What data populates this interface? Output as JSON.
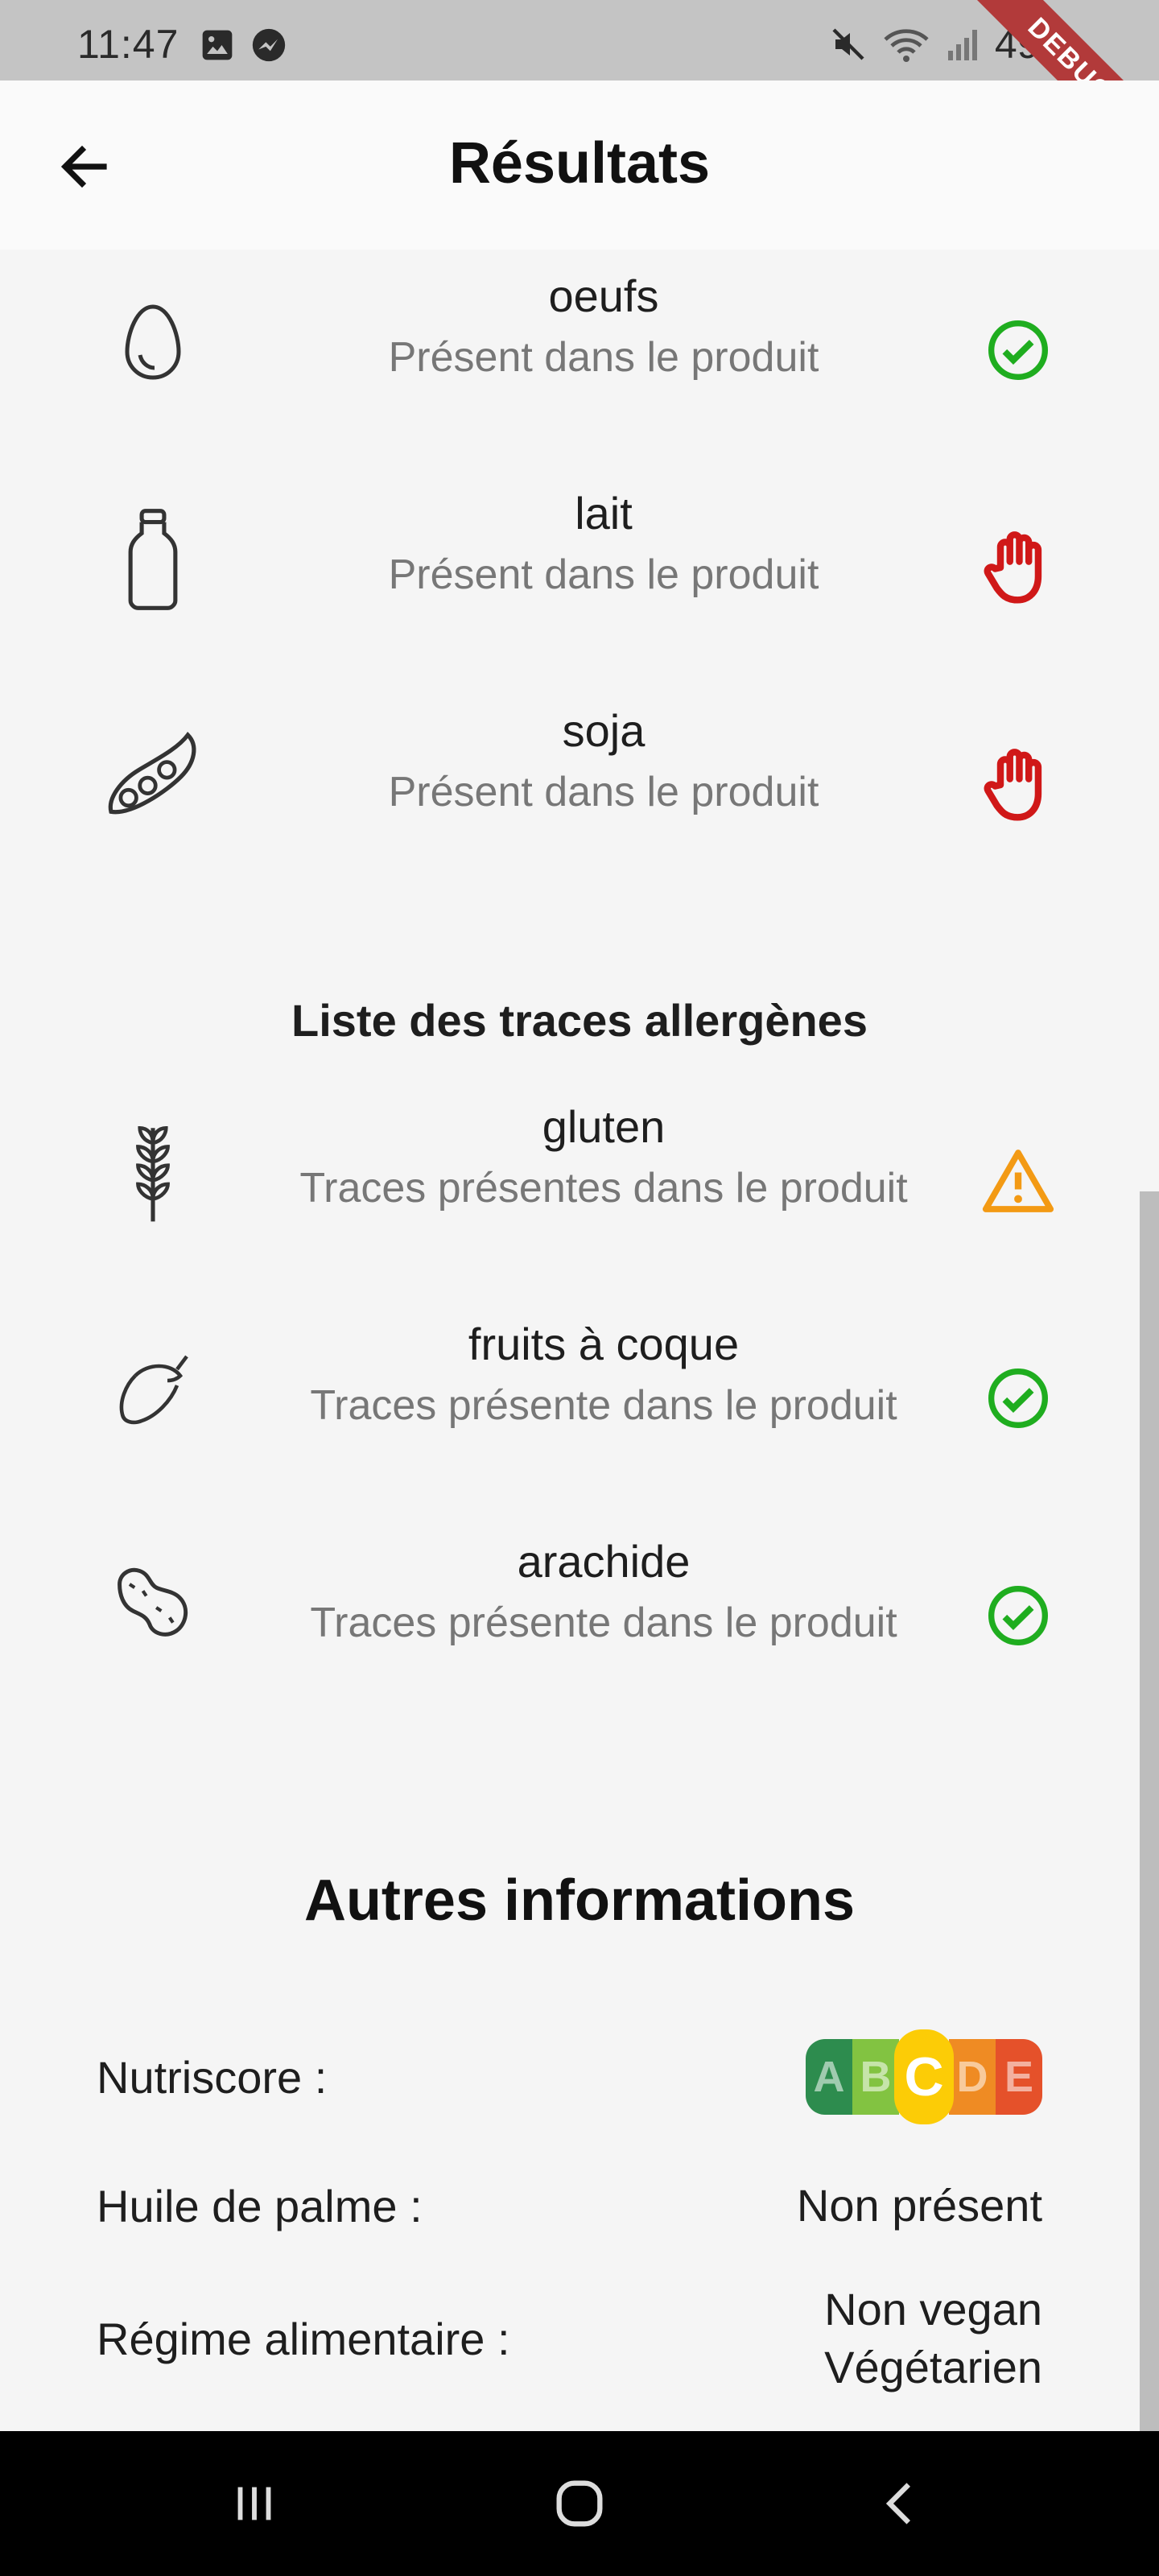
{
  "status_bar": {
    "time": "11:47",
    "battery": "49%",
    "debug_label": "DEBUG"
  },
  "app_bar": {
    "title": "Résultats"
  },
  "allergens": [
    {
      "name": "oeufs",
      "status_text": "Présent dans le produit",
      "icon": "egg-icon",
      "status_icon": "check-circle-icon"
    },
    {
      "name": "lait",
      "status_text": "Présent dans le produit",
      "icon": "milk-bottle-icon",
      "status_icon": "stop-hand-icon"
    },
    {
      "name": "soja",
      "status_text": "Présent dans le produit",
      "icon": "soy-pod-icon",
      "status_icon": "stop-hand-icon"
    }
  ],
  "traces_title": "Liste des traces allergènes",
  "traces": [
    {
      "name": "gluten",
      "status_text": "Traces présentes dans le produit",
      "icon": "wheat-icon",
      "status_icon": "warning-triangle-icon"
    },
    {
      "name": "fruits à coque",
      "status_text": "Traces présente dans le produit",
      "icon": "nut-icon",
      "status_icon": "check-circle-icon"
    },
    {
      "name": "arachide",
      "status_text": "Traces présente dans le produit",
      "icon": "peanut-icon",
      "status_icon": "check-circle-icon"
    }
  ],
  "other_info": {
    "title": "Autres informations",
    "nutriscore_label": "Nutriscore :",
    "nutriscore_grades": [
      "A",
      "B",
      "C",
      "D",
      "E"
    ],
    "nutriscore_selected": "C",
    "palm_oil_label": "Huile de palme :",
    "palm_oil_value": "Non présent",
    "diet_label": "Régime alimentaire :",
    "diet_values": [
      "Non vegan",
      "Végétarien"
    ]
  },
  "colors": {
    "ok": "#1fad1f",
    "stop": "#d01818",
    "warning": "#f39a14",
    "nutri_a": "#2d8c4e",
    "nutri_b": "#82c341",
    "nutri_c": "#fccc06",
    "nutri_d": "#ef8b23",
    "nutri_e": "#e5512a"
  }
}
